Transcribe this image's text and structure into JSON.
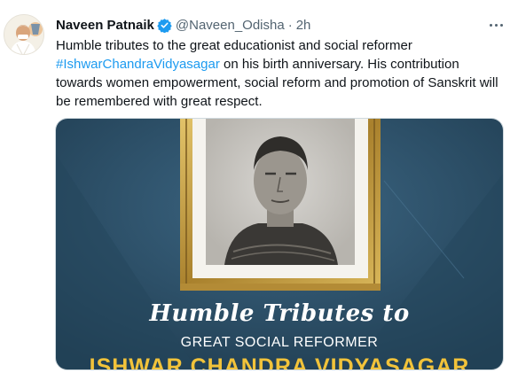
{
  "tweet": {
    "author_name": "Naveen Patnaik",
    "handle": "@Naveen_Odisha",
    "separator": "·",
    "time": "2h",
    "text_before": "Humble tributes to the great educationist and social reformer ",
    "hashtag": "#IshwarChandraVidyasagar",
    "text_after": " on his birth anniversary. His contribution towards women empowerment, social reform and promotion of Sanskrit will be remembered with great respect.",
    "verified_icon": "verified-badge-icon",
    "more_icon": "more-options-icon"
  },
  "media": {
    "caption_line1": "Humble Tributes to",
    "caption_line2": "GREAT SOCIAL REFORMER",
    "caption_line3": "ISHWAR CHANDRA VIDYASAGAR",
    "background_color": "#2c4f66",
    "frame_color": "#c9a54a",
    "accent_color": "#f2c33a"
  },
  "colors": {
    "link": "#1d9bf0",
    "secondary_text": "#536471",
    "verified": "#1d9bf0"
  }
}
